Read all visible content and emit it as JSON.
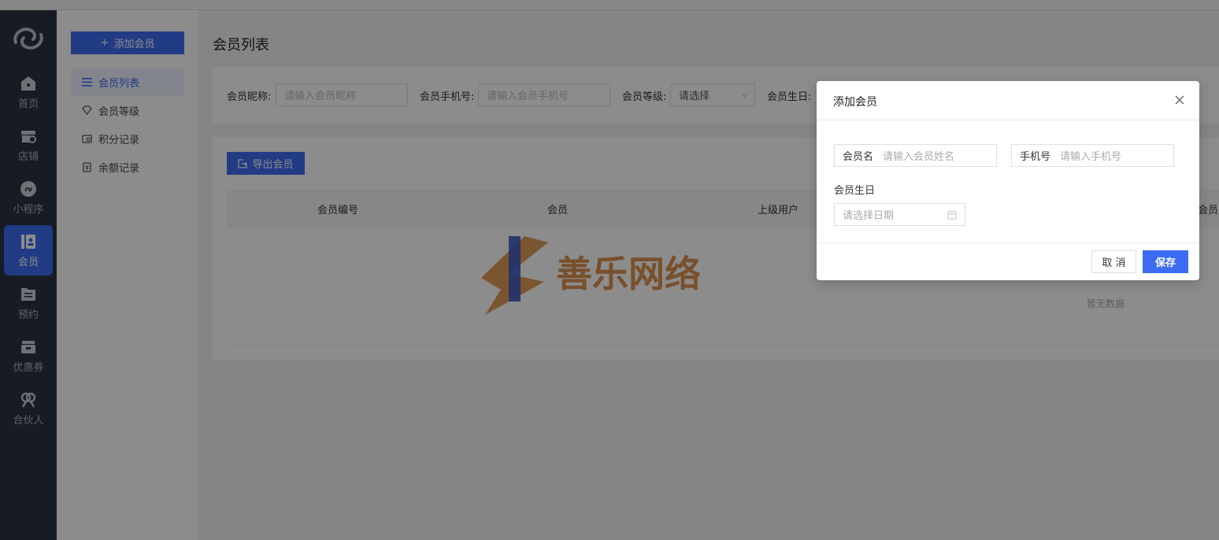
{
  "rail": {
    "items": [
      {
        "label": "首页",
        "icon": "home-icon"
      },
      {
        "label": "店铺",
        "icon": "store-icon"
      },
      {
        "label": "小程序",
        "icon": "mini-program-icon"
      },
      {
        "label": "会员",
        "icon": "member-icon",
        "active": true
      },
      {
        "label": "预约",
        "icon": "appointment-icon"
      },
      {
        "label": "优惠券",
        "icon": "coupon-icon"
      },
      {
        "label": "合伙人",
        "icon": "partner-icon"
      }
    ]
  },
  "subnav": {
    "add_button": "添加会员",
    "items": [
      {
        "label": "会员列表",
        "icon": "list-icon",
        "active": true
      },
      {
        "label": "会员等级",
        "icon": "diamond-icon"
      },
      {
        "label": "积分记录",
        "icon": "points-icon"
      },
      {
        "label": "余额记录",
        "icon": "balance-icon"
      }
    ]
  },
  "page": {
    "title": "会员列表",
    "filters": {
      "nickname_label": "会员昵称:",
      "nickname_placeholder": "请输入会员昵称",
      "phone_label": "会员手机号:",
      "phone_placeholder": "请输入会员手机号",
      "level_label": "会员等级:",
      "level_value": "请选择",
      "birthday_label": "会员生日:"
    },
    "export_button": "导出会员",
    "table": {
      "headers": [
        "会员编号",
        "会员",
        "上级用户",
        "会员"
      ],
      "empty_text": "暂无数据"
    }
  },
  "watermark": {
    "text": "善乐网络"
  },
  "modal": {
    "title": "添加会员",
    "name_label": "会员名",
    "name_placeholder": "请输入会员姓名",
    "phone_label": "手机号",
    "phone_placeholder": "请输入手机号",
    "birthday_label": "会员生日",
    "date_placeholder": "请选择日期",
    "cancel": "取 消",
    "save": "保存"
  },
  "colors": {
    "accent": "#3d6cf2",
    "rail": "#2b3443"
  }
}
